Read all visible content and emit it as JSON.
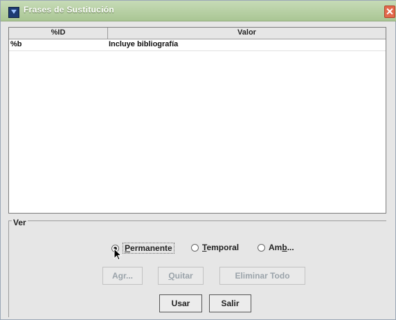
{
  "window": {
    "title": "Frases de Sustitución"
  },
  "table": {
    "columns": {
      "id": "%ID",
      "valor": "Valor"
    },
    "rows": [
      {
        "id": "%b",
        "valor": "Incluye bibliografía"
      }
    ]
  },
  "ver": {
    "legend": "Ver",
    "options": {
      "permanente": {
        "label": "Permanente",
        "checked": true
      },
      "temporal": {
        "label": "Temporal",
        "checked": false
      },
      "ambos": {
        "label": "Amb...",
        "checked": false
      }
    }
  },
  "buttons": {
    "agregar": "Agr...",
    "quitar": "Quitar",
    "eliminar_todo": "Eliminar Todo",
    "usar": "Usar",
    "salir": "Salir"
  },
  "icons": {
    "app": "app-icon",
    "close": "close-icon",
    "cursor": "mouse-pointer-icon"
  }
}
